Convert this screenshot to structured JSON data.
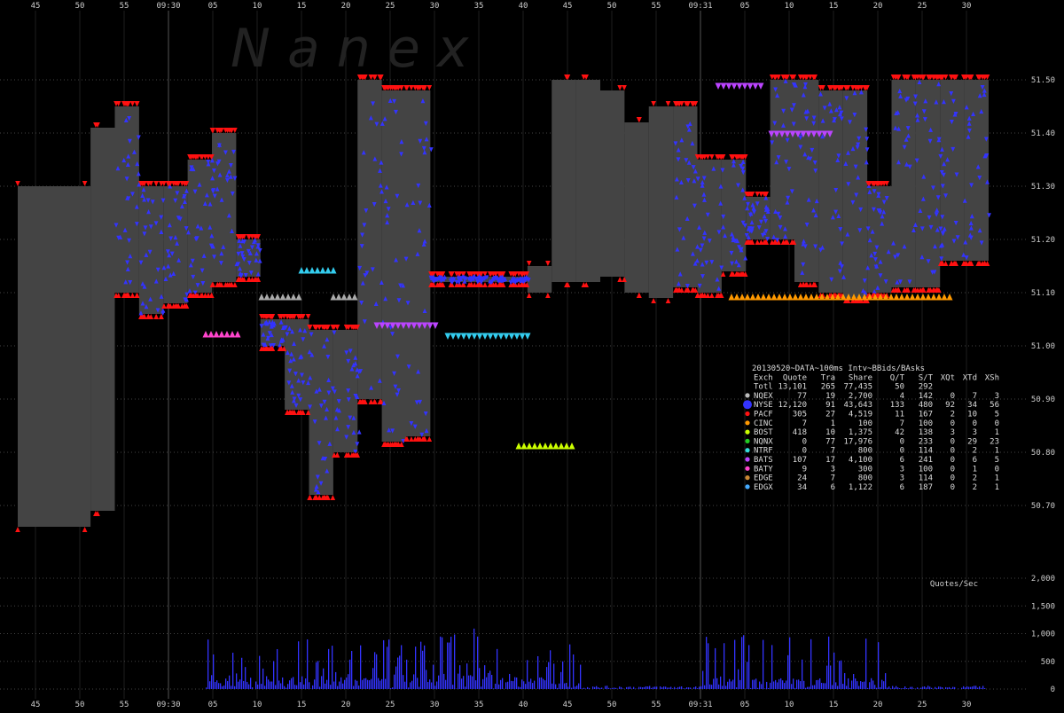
{
  "chart_data": [
    {
      "type": "area",
      "watermark": "N a n e x",
      "time_axis": {
        "ticks": [
          "45",
          "50",
          "55",
          "09:30",
          "05",
          "10",
          "15",
          "20",
          "25",
          "30",
          "35",
          "40",
          "45",
          "50",
          "55",
          "09:31",
          "05",
          "10",
          "15",
          "20",
          "25",
          "30"
        ]
      },
      "price_axis": {
        "ylim": [
          50.6,
          51.6
        ],
        "tick_labels": [
          "51.50",
          "51.40",
          "51.30",
          "51.20",
          "51.10",
          "51.00",
          "50.90",
          "50.80",
          "50.70"
        ],
        "tick_values": [
          51.5,
          51.4,
          51.3,
          51.2,
          51.1,
          51.0,
          50.9,
          50.8,
          50.7
        ]
      },
      "nbbo_band_x": [
        0,
        15,
        20,
        25,
        30,
        35,
        40,
        45,
        50,
        55,
        60,
        65,
        70,
        75,
        80,
        85,
        90,
        95,
        100,
        105,
        110,
        115,
        120,
        125,
        130,
        135,
        140,
        145,
        150,
        155,
        160,
        165,
        170,
        175,
        180,
        185,
        190,
        195,
        200
      ],
      "nbbo_band_bid": [
        50.66,
        50.69,
        51.1,
        51.06,
        51.08,
        51.1,
        51.12,
        51.13,
        51.0,
        50.88,
        50.72,
        50.8,
        50.9,
        50.82,
        50.83,
        51.12,
        51.12,
        51.12,
        51.12,
        51.1,
        51.12,
        51.12,
        51.13,
        51.1,
        51.09,
        51.11,
        51.1,
        51.14,
        51.2,
        51.2,
        51.12,
        51.1,
        51.09,
        51.1,
        51.11,
        51.11,
        51.16,
        51.16,
        51.16
      ],
      "nbbo_band_ask": [
        51.3,
        51.41,
        51.45,
        51.3,
        51.3,
        51.35,
        51.4,
        51.2,
        51.05,
        51.05,
        51.03,
        51.03,
        51.5,
        51.48,
        51.48,
        51.13,
        51.13,
        51.13,
        51.13,
        51.15,
        51.5,
        51.5,
        51.48,
        51.42,
        51.45,
        51.45,
        51.35,
        51.35,
        51.28,
        51.5,
        51.5,
        51.48,
        51.48,
        51.3,
        51.5,
        51.5,
        51.5,
        51.5,
        51.5
      ],
      "stats_table": {
        "title": "20130520~DATA~100ms Intv~BBids/BAsks",
        "columns": [
          "Exch",
          "Quote",
          "Tra",
          "Share",
          "Q/T",
          "S/T",
          "XQt",
          "XTd",
          "XSh"
        ],
        "rows": [
          {
            "exch": "Totl",
            "quote": "13,101",
            "tra": "265",
            "share": "77,435",
            "qt": "50",
            "st": "292",
            "xqt": "",
            "xtd": "",
            "xsh": "",
            "color": ""
          },
          {
            "exch": "NQEX",
            "quote": "77",
            "tra": "19",
            "share": "2,700",
            "qt": "4",
            "st": "142",
            "xqt": "0",
            "xtd": "7",
            "xsh": "3",
            "color": "#bbbbbb"
          },
          {
            "exch": "NYSE",
            "quote": "12,120",
            "tra": "91",
            "share": "43,643",
            "qt": "133",
            "st": "480",
            "xqt": "92",
            "xtd": "34",
            "xsh": "56",
            "color": "#3333ff"
          },
          {
            "exch": "PACF",
            "quote": "305",
            "tra": "27",
            "share": "4,519",
            "qt": "11",
            "st": "167",
            "xqt": "2",
            "xtd": "10",
            "xsh": "5",
            "color": "#ff1111"
          },
          {
            "exch": "CINC",
            "quote": "7",
            "tra": "1",
            "share": "100",
            "qt": "7",
            "st": "100",
            "xqt": "0",
            "xtd": "0",
            "xsh": "0",
            "color": "#ff9900"
          },
          {
            "exch": "BOST",
            "quote": "418",
            "tra": "10",
            "share": "1,375",
            "qt": "42",
            "st": "138",
            "xqt": "3",
            "xtd": "3",
            "xsh": "1",
            "color": "#ccff00"
          },
          {
            "exch": "NQNX",
            "quote": "0",
            "tra": "77",
            "share": "17,976",
            "qt": "0",
            "st": "233",
            "xqt": "0",
            "xtd": "29",
            "xsh": "23",
            "color": "#22cc22"
          },
          {
            "exch": "NTRF",
            "quote": "0",
            "tra": "7",
            "share": "800",
            "qt": "0",
            "st": "114",
            "xqt": "0",
            "xtd": "2",
            "xsh": "1",
            "color": "#33dddd"
          },
          {
            "exch": "BATS",
            "quote": "107",
            "tra": "17",
            "share": "4,100",
            "qt": "6",
            "st": "241",
            "xqt": "0",
            "xtd": "6",
            "xsh": "5",
            "color": "#bb44ff"
          },
          {
            "exch": "BATY",
            "quote": "9",
            "tra": "3",
            "share": "300",
            "qt": "3",
            "st": "100",
            "xqt": "0",
            "xtd": "1",
            "xsh": "0",
            "color": "#ff44cc"
          },
          {
            "exch": "EDGE",
            "quote": "24",
            "tra": "7",
            "share": "800",
            "qt": "3",
            "st": "114",
            "xqt": "0",
            "xtd": "2",
            "xsh": "1",
            "color": "#cc8833"
          },
          {
            "exch": "EDGX",
            "quote": "34",
            "tra": "6",
            "share": "1,122",
            "qt": "6",
            "st": "187",
            "xqt": "0",
            "xtd": "2",
            "xsh": "1",
            "color": "#44aaff"
          }
        ]
      }
    },
    {
      "type": "bar",
      "label": "Quotes/Sec",
      "ylim": [
        0,
        2000
      ],
      "tick_labels": [
        "2,000",
        "1,500",
        "1,000",
        "500",
        "0"
      ],
      "tick_values": [
        2000,
        1500,
        1000,
        500,
        0
      ]
    }
  ],
  "colors": {
    "background": "#000000",
    "band": "#444444",
    "grid": "#444444",
    "bid_marker": "#3333ff",
    "ask_marker": "#ff1111",
    "bats": "#bb44ff",
    "batz": "#ff44cc",
    "ntrf": "#33ccee",
    "cinc": "#ff9900",
    "bost": "#ccff00",
    "nqex": "#aaaaaa"
  }
}
